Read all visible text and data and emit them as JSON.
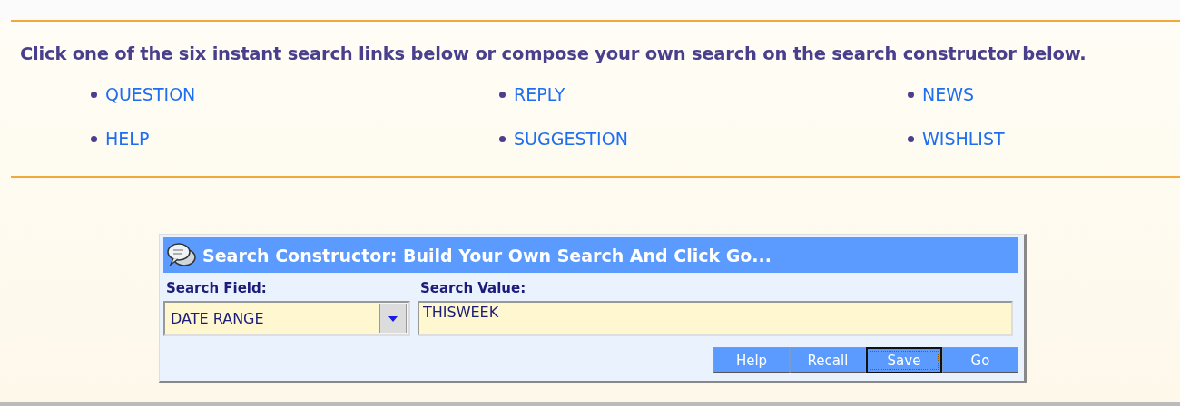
{
  "intro": "Click one of the six instant search links below or compose your own search on the search constructor below.",
  "links": [
    "QUESTION",
    "REPLY",
    "NEWS",
    "HELP",
    "SUGGESTION",
    "WISHLIST"
  ],
  "constructor": {
    "title": "Search Constructor: Build Your Own Search And Click Go...",
    "field_label": "Search Field:",
    "field_value": "DATE RANGE",
    "value_label": "Search Value:",
    "value": "THISWEEK",
    "buttons": [
      {
        "label": "Help",
        "focused": false
      },
      {
        "label": "Recall",
        "focused": false
      },
      {
        "label": "Save",
        "focused": true
      },
      {
        "label": "Go",
        "focused": false
      }
    ]
  }
}
